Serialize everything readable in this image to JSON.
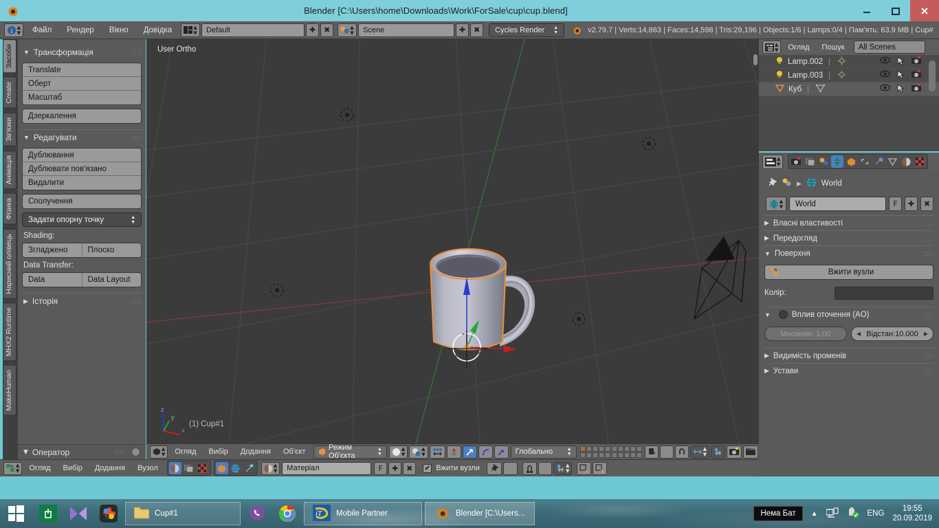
{
  "window": {
    "title": "Blender [C:\\Users\\home\\Downloads\\Work\\ForSale\\cup\\cup.blend]",
    "minimize": "—",
    "maximize": "❐",
    "close": "✕"
  },
  "top_header": {
    "menus": [
      "Файл",
      "Рендер",
      "Вікно",
      "Довідка"
    ],
    "screen_layout": "Default",
    "scene": "Scene",
    "engine": "Cycles Render",
    "stats": "v2.79.7 | Verts:14,863 | Faces:14,598 | Tris:29,196 | Objects:1/6 | Lamps:0/4 | Пам'ять: 63.9 MB | Cup#",
    "add_label": "✚",
    "remove_label": "✖"
  },
  "tool_tabs": [
    {
      "label": "Засоби",
      "active": true
    },
    {
      "label": "Create",
      "active": false
    },
    {
      "label": "Зв'язки",
      "active": false
    },
    {
      "label": "Анімація",
      "active": false
    },
    {
      "label": "Фізика",
      "active": false
    },
    {
      "label": "Нарисний олівець",
      "active": false
    },
    {
      "label": "MHX2 Runtime",
      "active": false
    },
    {
      "label": "MakeHuman",
      "active": false
    }
  ],
  "tool_panel": {
    "transform_title": "Трансформація",
    "transform_buttons": [
      "Translate",
      "Оберт",
      "Масштаб"
    ],
    "mirror_button": "Дзеркалення",
    "edit_title": "Редагувати",
    "edit_buttons": [
      "Дублювання",
      "Дублювати пов'язано",
      "Видалити"
    ],
    "join_button": "Сполучення",
    "origin_select": "Задати опорну точку",
    "shading_label": "Shading:",
    "shading_buttons": [
      "Згладжено",
      "Плоско"
    ],
    "data_transfer_label": "Data Transfer:",
    "data_buttons": [
      "Data",
      "Data Layout"
    ],
    "history_title": "Історія",
    "operator_title": "Оператор"
  },
  "viewport": {
    "view_label": "User Ortho",
    "object_label": "(1) Cup#1",
    "axis_x": "x",
    "axis_y": "y",
    "axis_z": "z"
  },
  "view_header": {
    "menus": [
      "Огляд",
      "Вибір",
      "Додання",
      "Об'єкт"
    ],
    "mode": "Режим Об'єкта",
    "orientation": "Глобально"
  },
  "outliner": {
    "menus": [
      "Огляд",
      "Пошук"
    ],
    "scene_filter": "All Scenes",
    "rows": [
      {
        "name": "Lamp.002",
        "type": "lamp",
        "selected": false
      },
      {
        "name": "Lamp.003",
        "type": "lamp",
        "selected": false
      },
      {
        "name": "Куб",
        "type": "mesh",
        "selected": true
      }
    ]
  },
  "properties": {
    "breadcrumb": "World",
    "datablock_name": "World",
    "fake_user": "F",
    "add": "✚",
    "unlink": "✖",
    "sections": [
      {
        "label": "Власні властивості",
        "open": false
      },
      {
        "label": "Передогляд",
        "open": false
      },
      {
        "label": "Поверхня",
        "open": true
      }
    ],
    "use_nodes_button": "Вжити вузли",
    "color_label": "Колір:",
    "ao_label": "Вплив оточення (AO)",
    "ao_factor": "Множник: 1.00",
    "ao_distance": "Відстан:10.000",
    "ray_visibility": "Видимість променів",
    "settings": "Устави"
  },
  "node_editor": {
    "menus": [
      "Огляд",
      "Вибір",
      "Додання",
      "Вузол"
    ],
    "material_name": "Матеріал",
    "fake_user": "F",
    "add": "✚",
    "unlink": "✖",
    "use_nodes_checkbox": "Вжити вузли"
  },
  "taskbar": {
    "tasks": [
      {
        "label": "Cup#1",
        "icon": "folder-icon"
      },
      {
        "label": "Mobile Partner",
        "icon": "mobile-partner-icon"
      },
      {
        "label": "Blender [C:\\Users...",
        "icon": "blender-icon"
      }
    ],
    "battery_tooltip": "Нема Бат",
    "language": "ENG",
    "time": "19:55",
    "date": "20.09.2019"
  },
  "colors": {
    "accent_blue": "#4f7dc0",
    "title_bar": "#7ecfdb",
    "close_red": "#c75b5b",
    "selection_orange": "#e8913c",
    "panel_gray": "#5a5a5a",
    "viewport_bg": "#3b3b3b"
  }
}
